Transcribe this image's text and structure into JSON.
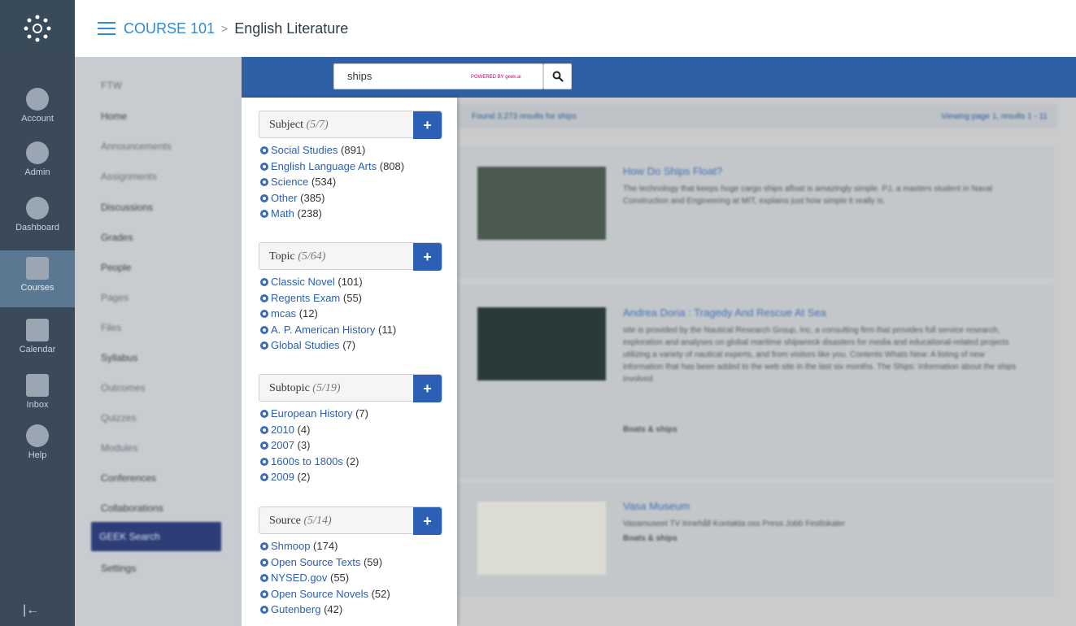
{
  "header": {
    "course_link": "COURSE 101",
    "separator": ">",
    "page_name": "English Literature"
  },
  "global_nav": {
    "items": [
      {
        "label": "Account",
        "icon": "account-icon"
      },
      {
        "label": "Admin",
        "icon": "admin-icon"
      },
      {
        "label": "Dashboard",
        "icon": "dashboard-icon"
      },
      {
        "label": "Courses",
        "icon": "courses-icon"
      },
      {
        "label": "Calendar",
        "icon": "calendar-icon"
      },
      {
        "label": "Inbox",
        "icon": "inbox-icon"
      },
      {
        "label": "Help",
        "icon": "help-icon"
      }
    ]
  },
  "course_nav": {
    "items": [
      {
        "label": "FTW"
      },
      {
        "label": "Home"
      },
      {
        "label": "Announcements"
      },
      {
        "label": "Assignments"
      },
      {
        "label": "Discussions"
      },
      {
        "label": "Grades"
      },
      {
        "label": "People"
      },
      {
        "label": "Pages"
      },
      {
        "label": "Files"
      },
      {
        "label": "Syllabus"
      },
      {
        "label": "Outcomes"
      },
      {
        "label": "Quizzes"
      },
      {
        "label": "Modules"
      },
      {
        "label": "Conferences"
      },
      {
        "label": "Collaborations"
      },
      {
        "label": "GEEK Search"
      },
      {
        "label": "Settings"
      }
    ]
  },
  "search": {
    "value": "ships",
    "powered_by": "POWERED BY geek.ai"
  },
  "results": {
    "status_left": "Found 3,273 results for ships",
    "status_right": "Viewing page 1, results 1 - 11",
    "items": [
      {
        "title": "How Do Ships Float?",
        "description": "The technology that keeps huge cargo ships afloat is amazingly simple. PJ, a masters student in Naval Construction and Engineering at MIT, explains just how simple it really is."
      },
      {
        "title": "Andrea Doria : Tragedy And Rescue At Sea",
        "description": "site is provided by the Nautical Research Group, Inc, a consulting firm that provides full service research, exploration and analyses on global maritime shipwreck disasters for media and educational-related projects utilizing a variety of nautical experts, and from visitors like you. Contents Whats New: A listing of new information that has been added to the web site in the last six months. The Ships: Information about the ships involved",
        "tag": "Boats & ships"
      },
      {
        "title": "Vasa Museum",
        "description": "Vasamuseet TV Innehåll Kontakta oss Press Jobb Festlokaler",
        "tag": "Boats & ships"
      }
    ]
  },
  "facets": [
    {
      "name": "Subject",
      "count": "(5/7)",
      "items": [
        {
          "label": "Social Studies",
          "count": "(891)"
        },
        {
          "label": "English Language Arts",
          "count": "(808)"
        },
        {
          "label": "Science",
          "count": "(534)"
        },
        {
          "label": "Other",
          "count": "(385)"
        },
        {
          "label": "Math",
          "count": "(238)"
        }
      ]
    },
    {
      "name": "Topic",
      "count": "(5/64)",
      "items": [
        {
          "label": "Classic Novel",
          "count": "(101)"
        },
        {
          "label": "Regents Exam",
          "count": "(55)"
        },
        {
          "label": "mcas",
          "count": "(12)"
        },
        {
          "label": "A. P. American History",
          "count": "(11)"
        },
        {
          "label": "Global Studies",
          "count": "(7)"
        }
      ]
    },
    {
      "name": "Subtopic",
      "count": "(5/19)",
      "items": [
        {
          "label": "European History",
          "count": "(7)"
        },
        {
          "label": "2010",
          "count": "(4)"
        },
        {
          "label": "2007",
          "count": "(3)"
        },
        {
          "label": "1600s to 1800s",
          "count": "(2)"
        },
        {
          "label": "2009",
          "count": "(2)"
        }
      ]
    },
    {
      "name": "Source",
      "count": "(5/14)",
      "items": [
        {
          "label": "Shmoop",
          "count": "(174)"
        },
        {
          "label": "Open Source Texts",
          "count": "(59)"
        },
        {
          "label": "NYSED.gov",
          "count": "(55)"
        },
        {
          "label": "Open Source Novels",
          "count": "(52)"
        },
        {
          "label": "Gutenberg",
          "count": "(42)"
        }
      ]
    }
  ],
  "colors": {
    "topbar": "#2f5fa5",
    "link": "#2c5fb0",
    "course_link": "#2d8cd8",
    "global_nav": "#3a4a5a"
  }
}
